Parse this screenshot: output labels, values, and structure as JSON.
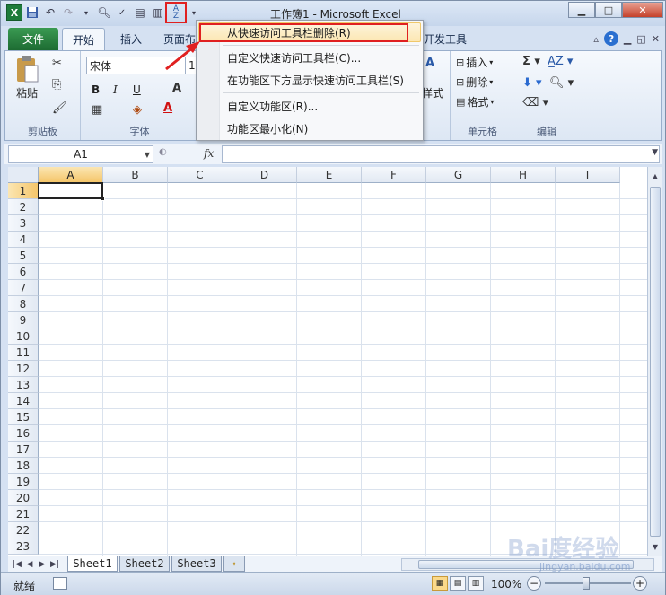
{
  "window": {
    "title": "工作簿1 - Microsoft Excel"
  },
  "quick_access": [
    "excel-icon",
    "save-icon",
    "undo-icon",
    "redo-icon",
    "print-preview-icon",
    "spelling-icon",
    "print-icon",
    "quick-print-icon",
    "sort-az-icon",
    "customize-dropdown-icon"
  ],
  "tabs": [
    {
      "label": "文件"
    },
    {
      "label": "开始"
    },
    {
      "label": "插入"
    },
    {
      "label": "页面布"
    },
    {
      "label": "开发工具"
    }
  ],
  "ribbon": {
    "clipboard": {
      "paste_label": "粘贴",
      "group_label": "剪贴板"
    },
    "font": {
      "font_name": "宋体",
      "font_size": "11",
      "bold": "B",
      "italic": "I",
      "underline": "U",
      "group_label": "字体"
    },
    "styles": {
      "label": "样式"
    },
    "cells": {
      "insert_label": "插入",
      "delete_label": "删除",
      "format_label": "格式",
      "group_label": "单元格"
    },
    "editing": {
      "group_label": "编辑"
    }
  },
  "context_menu": {
    "items": [
      {
        "label": "从快速访问工具栏删除(R)",
        "highlighted": true
      },
      {
        "label": "自定义快速访问工具栏(C)..."
      },
      {
        "label": "在功能区下方显示快速访问工具栏(S)"
      },
      {
        "label": "自定义功能区(R)..."
      },
      {
        "label": "功能区最小化(N)"
      }
    ]
  },
  "formula_bar": {
    "name_box": "A1",
    "fx_label": "fx",
    "formula": ""
  },
  "grid": {
    "columns": [
      "A",
      "B",
      "C",
      "D",
      "E",
      "F",
      "G",
      "H",
      "I"
    ],
    "rows": [
      "1",
      "2",
      "3",
      "4",
      "5",
      "6",
      "7",
      "8",
      "9",
      "10",
      "11",
      "12",
      "13",
      "14",
      "15",
      "16",
      "17",
      "18",
      "19",
      "20",
      "21",
      "22",
      "23"
    ],
    "active_cell": "A1"
  },
  "sheets": [
    {
      "label": "Sheet1",
      "active": true
    },
    {
      "label": "Sheet2"
    },
    {
      "label": "Sheet3"
    }
  ],
  "status": {
    "ready": "就绪",
    "zoom": "100%"
  },
  "watermark": {
    "text": "Bai度经验",
    "url": "jingyan.baidu.com"
  },
  "colors": {
    "accent_red": "#e02020",
    "file_tab": "#1d6b32",
    "selected_header": "#f5c66a"
  }
}
